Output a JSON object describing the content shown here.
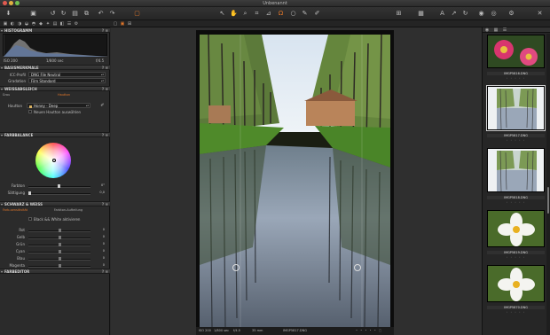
{
  "window": {
    "title": "Unbenannt"
  },
  "toolbar": {
    "icons": [
      "import-icon",
      "folder-icon",
      "rotate-left-icon",
      "rotate-right-icon",
      "export-icon",
      "undo-icon",
      "redo-icon",
      "capture-icon",
      "cursor-icon",
      "pan-icon",
      "zoom-icon",
      "crop-icon",
      "straighten-icon",
      "keystone-icon",
      "spot-icon",
      "brush-icon",
      "picker-icon",
      "grid-icon",
      "table-icon",
      "text-icon",
      "pin-icon",
      "rotate-icon",
      "camera-icon",
      "stop-icon",
      "gear-icon",
      "tools-icon"
    ]
  },
  "histogram": {
    "title": "HISTOGRAMM",
    "iso": "ISO 200",
    "shutter": "1/800 sec",
    "aperture": "f/4.5"
  },
  "base": {
    "title": "BASISMERKMALE",
    "icc_label": "ICC-Profil",
    "icc_value": "DNG File Neutral",
    "gradation_label": "Gradation",
    "gradation_value": "Film Standard"
  },
  "wb": {
    "title": "WEISSABGLEICH",
    "tab_gray": "Grau",
    "tab_skin": "Hautton",
    "skin_label": "Hautton",
    "skin_value": "Honey - Deep",
    "new_skin_label": "Neuen Hautton auswählen"
  },
  "color_balance": {
    "title": "FARBBALANCE",
    "hue_label": "Farbton",
    "hue_value": "0°",
    "sat_label": "Sättigung",
    "sat_value": "0,0",
    "hue_fraction": 0.5,
    "sat_fraction": 0.02
  },
  "bw": {
    "title": "SCHWARZ & WEISS",
    "tab_conversion": "Farb-sensitivität",
    "tab_split": "Farbton-Aufteilung",
    "enable_label": "Black && White aktivieren",
    "channels": [
      {
        "label": "Rot",
        "value": "0"
      },
      {
        "label": "Gelb",
        "value": "0"
      },
      {
        "label": "Grün",
        "value": "0"
      },
      {
        "label": "Cyan",
        "value": "0"
      },
      {
        "label": "Blau",
        "value": "0"
      },
      {
        "label": "Magenta",
        "value": "0"
      }
    ]
  },
  "color_editor": {
    "title": "FARBEDITOR"
  },
  "viewer": {
    "status_iso": "ISO 200",
    "status_shutter": "1/800 sec",
    "status_aperture": "f/4.5",
    "status_focal": "35 mm",
    "status_file": "IMGP5817.DNG"
  },
  "browser": {
    "items": [
      {
        "label": "IMGP5816.DNG",
        "kind": "flower-red"
      },
      {
        "label": "IMGP5817.DNG",
        "kind": "canal",
        "selected": true
      },
      {
        "label": "IMGP5818.DNG",
        "kind": "canal"
      },
      {
        "label": "IMGP5819.DNG",
        "kind": "flower-white"
      },
      {
        "label": "IMGP5870.DNG",
        "kind": "flower-white"
      }
    ]
  },
  "colors": {
    "accent": "#e0762a",
    "panel": "#2b2b2b",
    "selection": "#3a6fc0"
  }
}
